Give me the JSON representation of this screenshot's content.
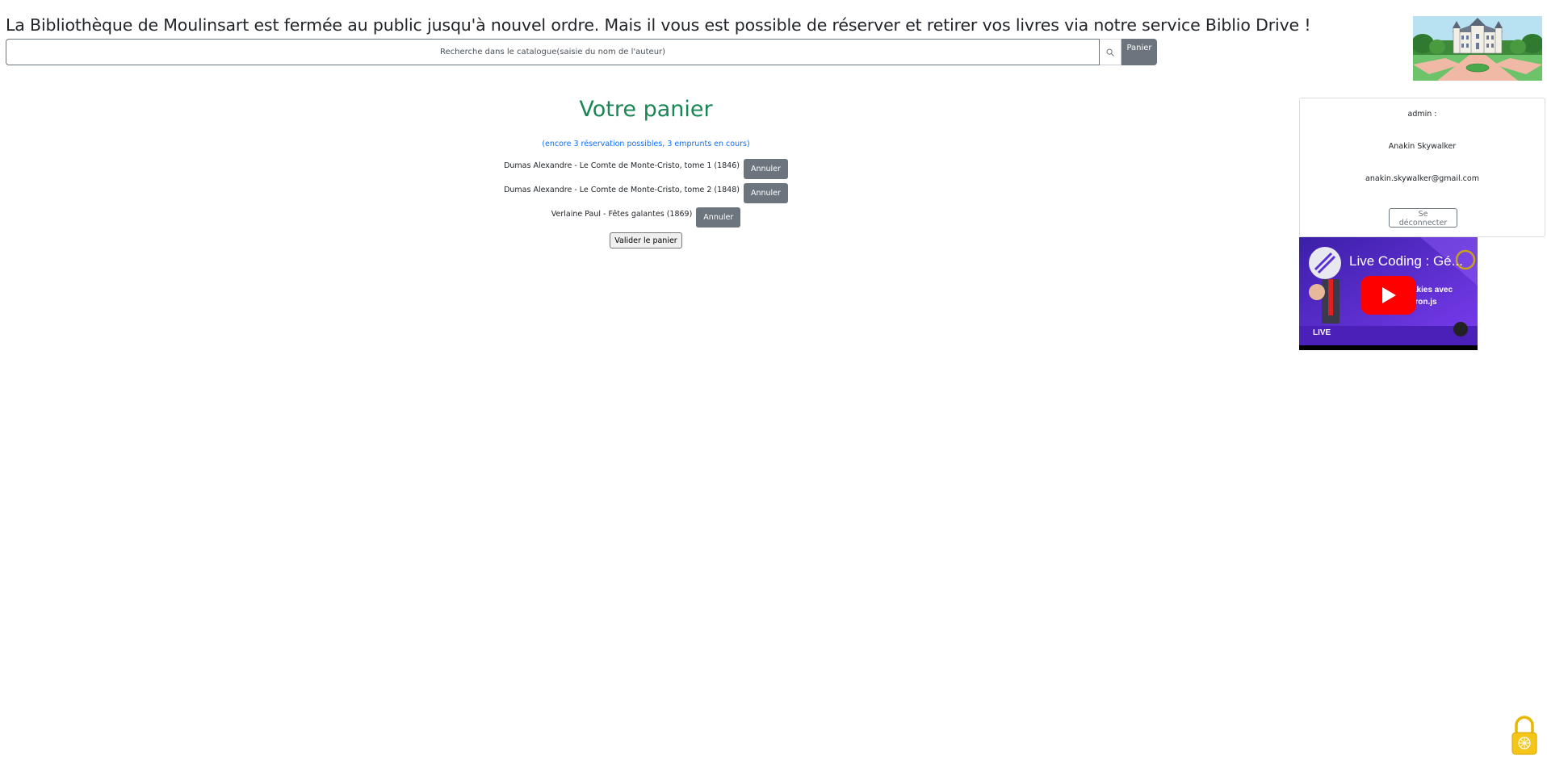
{
  "header": {
    "announcement": "La Bibliothèque de Moulinsart est fermée au public jusqu'à nouvel ordre. Mais il vous est possible de réserver et retirer vos livres via notre service Biblio Drive !"
  },
  "search": {
    "placeholder": "Recherche dans le catalogue(saisie du nom de l'auteur)",
    "value": "",
    "button_icon": "search-icon",
    "panier_label": "Panier"
  },
  "cart": {
    "title": "Votre panier",
    "subtitle": "(encore 3 réservation possibles, 3 emprunts en cours)",
    "items": [
      {
        "label": "Dumas Alexandre - Le Comte de Monte-Cristo, tome 1 (1846)",
        "action": "Annuler"
      },
      {
        "label": "Dumas Alexandre - Le Comte de Monte-Cristo, tome 2 (1848)",
        "action": "Annuler"
      },
      {
        "label": "Verlaine Paul - Fêtes galantes (1869)",
        "action": "Annuler"
      }
    ],
    "validate_label": "Valider le panier"
  },
  "user": {
    "role": "admin :",
    "name": "Anakin Skywalker",
    "email": "anakin.skywalker@gmail.com",
    "logout_label": "Se déconnecter"
  },
  "video": {
    "title": "Live Coding : Gé...",
    "overlay_text_1": "akies avec",
    "overlay_text_2": "tron.js",
    "live_label": "LIVE",
    "play_icon": "play-icon"
  },
  "colors": {
    "title_green": "#198754",
    "subtitle_blue": "#0d6efd",
    "button_gray": "#6c757d",
    "youtube_red": "#ff0000",
    "video_purple": "#5b2fd6",
    "lock_yellow": "#f5c518"
  }
}
